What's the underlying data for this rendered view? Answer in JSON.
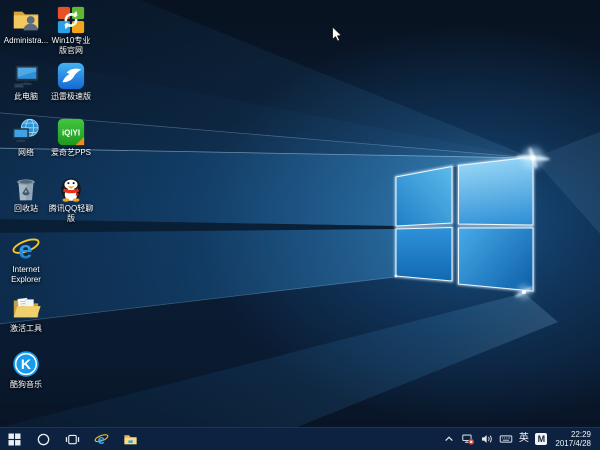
{
  "wallpaper": {
    "name": "windows-10-hero",
    "base_color": "#0a1a30",
    "beam_color": "#2e9be4",
    "logo_edge_color": "#eaf7ff"
  },
  "desktop": {
    "icons": [
      {
        "id": "administrator",
        "label": "Administra...",
        "icon": "user-folder",
        "col": 0,
        "row": 0
      },
      {
        "id": "win10-pro-site",
        "label": "Win10专业版官网",
        "icon": "win10-refresh",
        "col": 1,
        "row": 0
      },
      {
        "id": "this-pc",
        "label": "此电脑",
        "icon": "monitor-pc",
        "col": 0,
        "row": 1
      },
      {
        "id": "xunlei",
        "label": "迅雷极速版",
        "icon": "xunlei-bird",
        "col": 1,
        "row": 1
      },
      {
        "id": "network",
        "label": "网络",
        "icon": "network-globe",
        "col": 0,
        "row": 2
      },
      {
        "id": "iqiyi-pps",
        "label": "爱奇艺PPS",
        "icon": "iqiyi",
        "col": 1,
        "row": 2
      },
      {
        "id": "recycle-bin",
        "label": "回收站",
        "icon": "recycle-bin",
        "col": 0,
        "row": 3
      },
      {
        "id": "qq-light",
        "label": "腾讯QQ轻聊版",
        "icon": "qq-penguin",
        "col": 1,
        "row": 3
      },
      {
        "id": "internet-explorer",
        "label": "Internet Explorer",
        "icon": "ie",
        "col": 0,
        "row": 4
      },
      {
        "id": "activation-tool",
        "label": "激活工具",
        "icon": "docs-folder",
        "col": 0,
        "row": 5
      },
      {
        "id": "kugou-music",
        "label": "酷狗音乐",
        "icon": "kugou",
        "col": 0,
        "row": 6
      }
    ]
  },
  "taskbar": {
    "buttons": [
      {
        "id": "start",
        "icon": "windows-flag"
      },
      {
        "id": "cortana-search",
        "icon": "circle-outline"
      },
      {
        "id": "task-view",
        "icon": "task-view"
      },
      {
        "id": "internet-explorer",
        "icon": "ie-small"
      },
      {
        "id": "file-explorer",
        "icon": "explorer-folder"
      }
    ],
    "tray": {
      "icons": [
        {
          "id": "hidden-icons",
          "icon": "chevron-up"
        },
        {
          "id": "network-status",
          "icon": "network-disconnected"
        },
        {
          "id": "volume",
          "icon": "speaker"
        },
        {
          "id": "touch-keyboard",
          "icon": "keyboard"
        }
      ],
      "language_indicator": "英",
      "ime_badge": "M",
      "clock": {
        "time": "22:29",
        "date": "2017/4/28"
      }
    }
  }
}
